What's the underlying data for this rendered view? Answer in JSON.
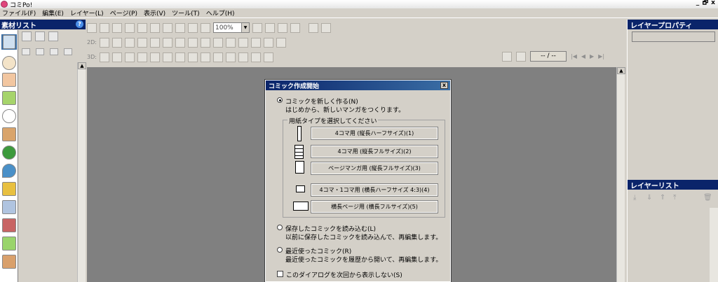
{
  "window": {
    "title": "コミPo!",
    "controls": [
      "_",
      "🗗",
      "x"
    ]
  },
  "menu": [
    "ファイル(F)",
    "編集(E)",
    "レイヤー(L)",
    "ページ(P)",
    "表示(V)",
    "ツール(T)",
    "ヘルプ(H)"
  ],
  "left_panel": {
    "title": "素材リスト",
    "help": "?"
  },
  "toolbar": {
    "zoom_value": "100%",
    "row2_label": "2D:",
    "row3_label": "3D:"
  },
  "page_nav": {
    "page_text": "-- / --"
  },
  "right_panel": {
    "properties_title": "レイヤープロパティ",
    "layers_title": "レイヤーリスト"
  },
  "dialog": {
    "title": "コミック作成開始",
    "close": "x",
    "option_new": {
      "label": "コミックを新しく作る(N)",
      "desc": "はじめから、新しいマンガをつくります。"
    },
    "paper_group_label": "用紙タイプを選択してください",
    "paper_buttons": [
      "4コマ用 (縦長ハーフサイズ)(1)",
      "4コマ用 (縦長フルサイズ)(2)",
      "ページマンガ用 (縦長フルサイズ)(3)",
      "4コマ・1コマ用 (横長ハーフサイズ 4:3)(4)",
      "横長ページ用 (横長フルサイズ)(5)"
    ],
    "option_load": {
      "label": "保存したコミックを読み込む(L)",
      "desc": "以前に保存したコミックを読み込んで、再編集します。"
    },
    "option_recent": {
      "label": "最近使ったコミック(R)",
      "desc": "最近使ったコミックを履歴から開いて、再編集します。"
    },
    "dont_show_label": "このダイアログを次回から表示しない(S)"
  }
}
